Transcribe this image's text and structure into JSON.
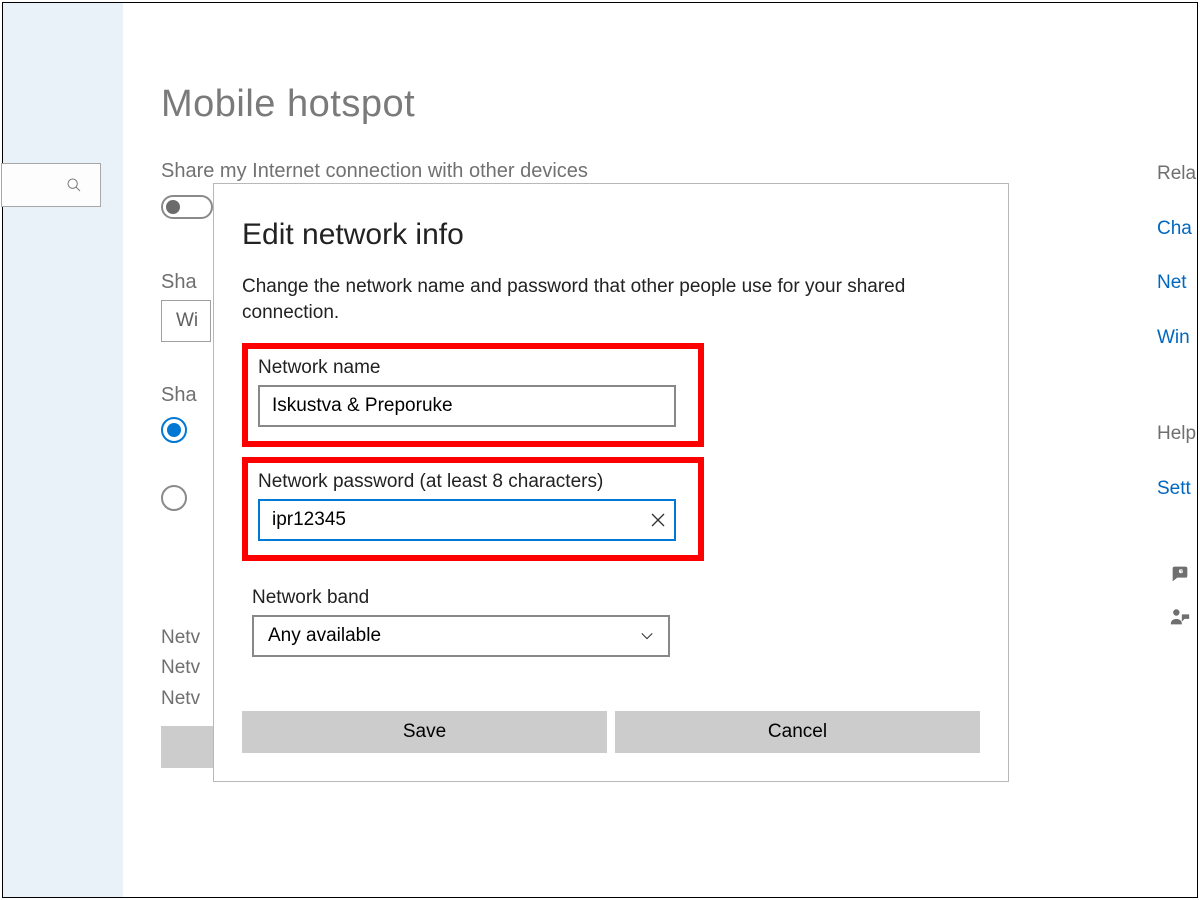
{
  "page": {
    "title": "Mobile hotspot",
    "share_label": "Share my Internet connection with other devices",
    "share_from_label": "Sha",
    "share_from_value": "Wi",
    "share_over_label": "Sha",
    "info_labels": [
      "Netv",
      "Netv",
      "Netv"
    ]
  },
  "dialog": {
    "title": "Edit network info",
    "description": "Change the network name and password that other people use for your shared connection.",
    "network_name_label": "Network name",
    "network_name_value": "Iskustva & Preporuke",
    "password_label": "Network password (at least 8 characters)",
    "password_value": "ipr12345",
    "band_label": "Network band",
    "band_value": "Any available",
    "save_label": "Save",
    "cancel_label": "Cancel"
  },
  "right": {
    "related_heading": "Rela",
    "link1": "Cha",
    "link2": "Net",
    "link3": "Win",
    "help_heading": "Help",
    "help_link": "Sett"
  }
}
